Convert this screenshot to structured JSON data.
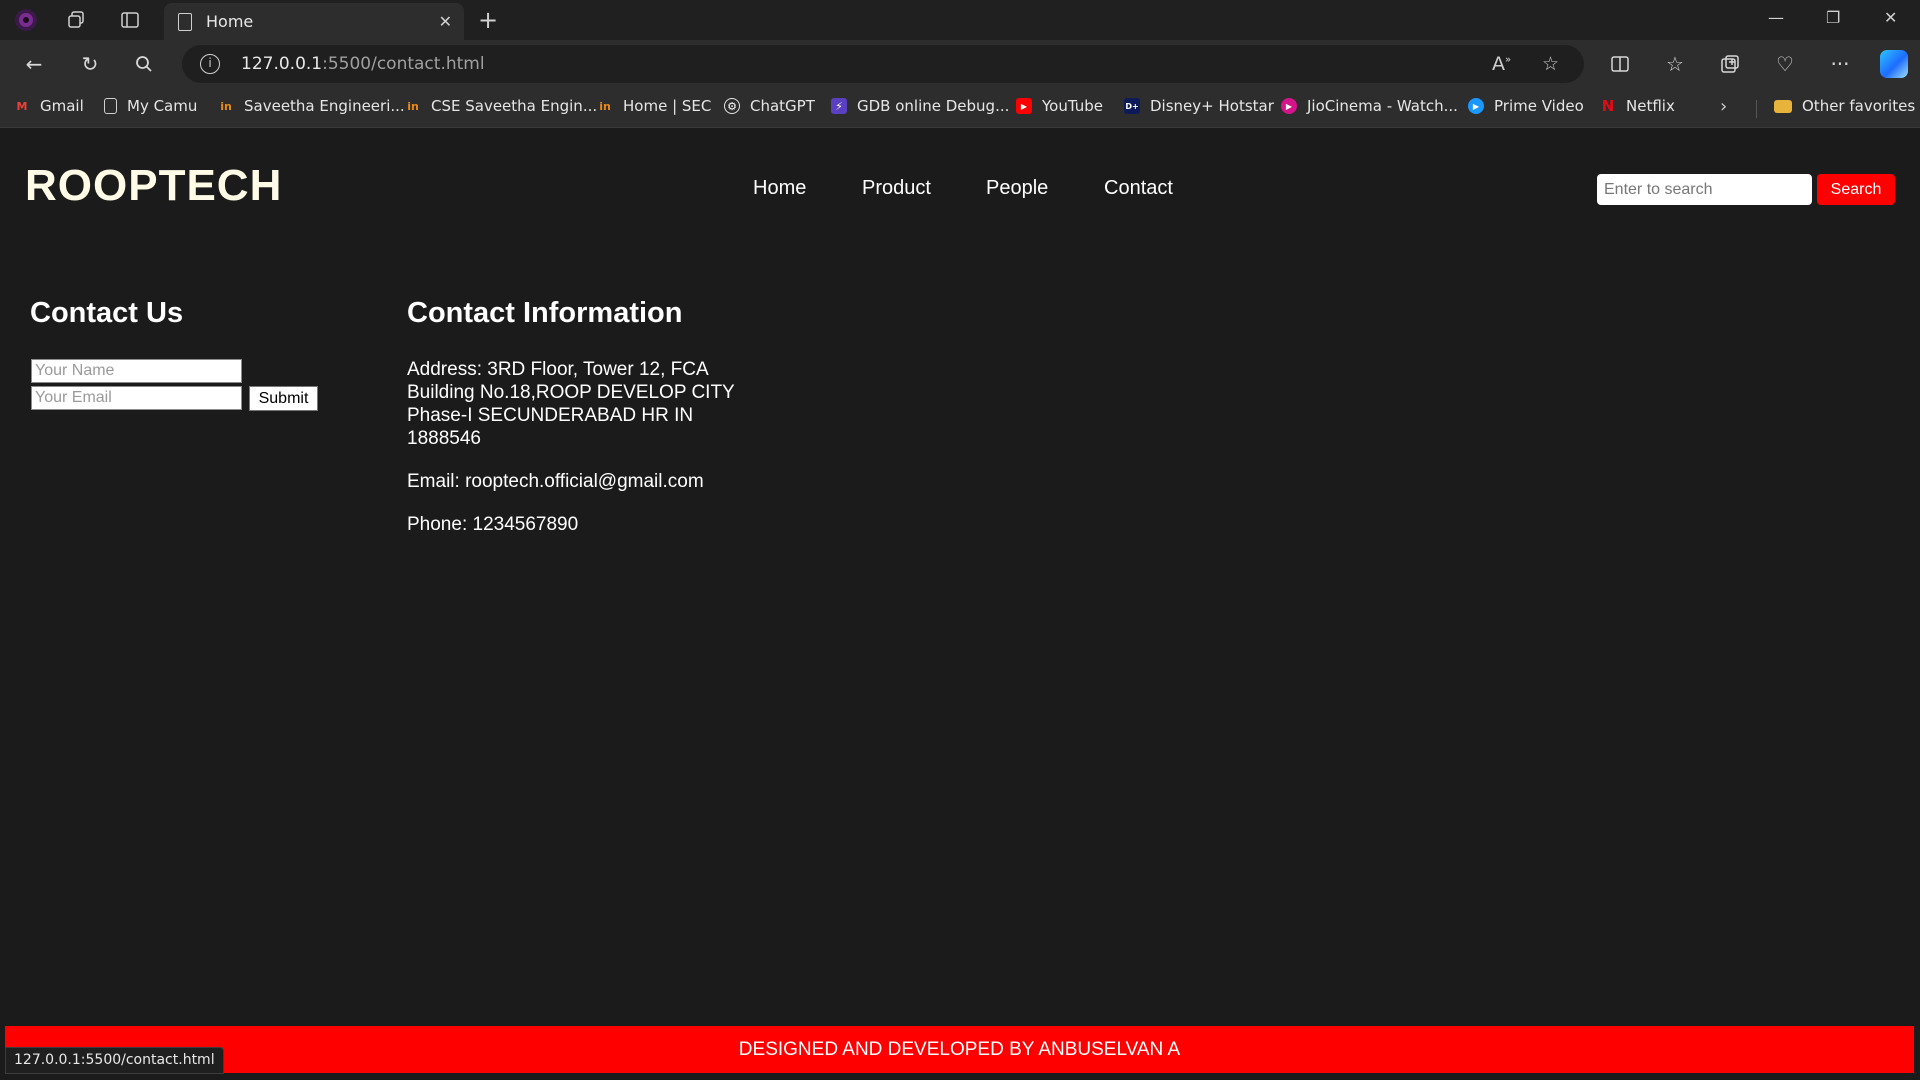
{
  "browser": {
    "tab_title": "Home",
    "url_host": "127.0.0.1",
    "url_rest": ":5500/contact.html",
    "status_url": "127.0.0.1:5500/contact.html",
    "bookmarks": [
      {
        "label": "Gmail",
        "icon": "gmail-icon"
      },
      {
        "label": "My Camu",
        "icon": "page-icon"
      },
      {
        "label": "Saveetha Engineeri...",
        "icon": "saveetha-icon"
      },
      {
        "label": "CSE Saveetha Engin...",
        "icon": "saveetha-icon"
      },
      {
        "label": "Home | SEC",
        "icon": "saveetha-icon"
      },
      {
        "label": "ChatGPT",
        "icon": "chatgpt-icon"
      },
      {
        "label": "GDB online Debug...",
        "icon": "gdb-icon"
      },
      {
        "label": "YouTube",
        "icon": "youtube-icon"
      },
      {
        "label": "Disney+ Hotstar",
        "icon": "hotstar-icon"
      },
      {
        "label": "JioCinema - Watch...",
        "icon": "jiocinema-icon"
      },
      {
        "label": "Prime Video",
        "icon": "primevideo-icon"
      },
      {
        "label": "Netflix",
        "icon": "netflix-icon"
      }
    ],
    "other_favorites": "Other favorites"
  },
  "site": {
    "logo": "ROOPTECH",
    "nav": [
      "Home",
      "Product",
      "People",
      "Contact"
    ],
    "search_placeholder": "Enter to search",
    "search_button": "Search"
  },
  "contact_form": {
    "heading": "Contact Us",
    "name_placeholder": "Your Name",
    "email_placeholder": "Your Email",
    "submit_label": "Submit"
  },
  "contact_info": {
    "heading": "Contact Information",
    "address_lines": [
      "Address: 3RD Floor, Tower 12, FCA",
      "Building No.18,ROOP DEVELOP CITY",
      "Phase-I SECUNDERABAD HR IN",
      "1888546"
    ],
    "email": "Email: rooptech.official@gmail.com",
    "phone": "Phone: 1234567890"
  },
  "footer": {
    "text": "DESIGNED AND DEVELOPED BY ANBUSELVAN A"
  },
  "colors": {
    "page_bg": "#1b1b1b",
    "accent_red": "#ff0000",
    "logo_color": "#fffbe6"
  }
}
